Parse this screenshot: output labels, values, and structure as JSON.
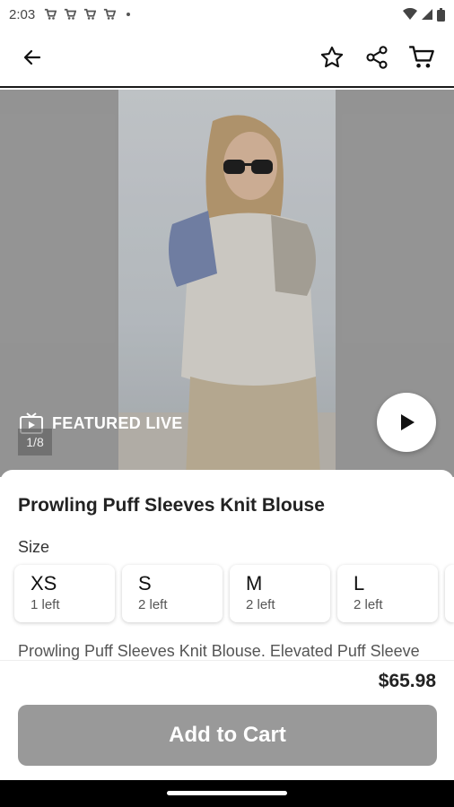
{
  "status_bar": {
    "time": "2:03"
  },
  "app_bar": {
    "back_icon": "arrow-left-icon",
    "favorite_icon": "star-icon",
    "share_icon": "share-icon",
    "cart_icon": "cart-icon"
  },
  "hero": {
    "featured_label": "FEATURED LIVE",
    "image_counter": "1/8",
    "play_icon": "play-icon"
  },
  "product": {
    "title": "Prowling Puff Sleeves Knit Blouse",
    "size_label": "Size",
    "sizes": [
      {
        "name": "XS",
        "stock": "1 left"
      },
      {
        "name": "S",
        "stock": "2 left"
      },
      {
        "name": "M",
        "stock": "2 left"
      },
      {
        "name": "L",
        "stock": "2 left"
      }
    ],
    "description": "Prowling Puff Sleeves Knit Blouse. Elevated Puff Sleeve",
    "price": "$65.98",
    "add_to_cart": "Add to Cart"
  },
  "colors": {
    "button_bg": "#999999",
    "text": "#1f1f1f"
  }
}
